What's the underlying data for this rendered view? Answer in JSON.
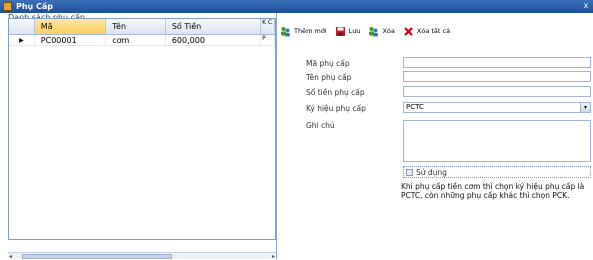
{
  "window": {
    "title": "Phụ Cấp",
    "close_glyph": "x"
  },
  "list": {
    "label": "Danh sách phụ cấp",
    "columns": [
      "Mã",
      "Tên",
      "Số Tiền",
      "K C"
    ],
    "rows": [
      {
        "indicator": "▶",
        "ma": "PC00001",
        "ten": "cơm",
        "so_tien": "600,000",
        "k": "P"
      }
    ],
    "scroll_left": "◂",
    "scroll_right": "▸"
  },
  "toolbar": {
    "add_label": "Thêm mới",
    "save_label": "Lưu",
    "delete_label": "Xóa",
    "delete_all_label": "Xóa tất cả"
  },
  "form": {
    "ma_label": "Mã phụ cấp",
    "ma_value": "",
    "ten_label": "Tên phụ cấp",
    "ten_value": "",
    "so_tien_label": "Số tiền phụ cấp",
    "so_tien_value": "",
    "ky_hieu_label": "Ký hiệu phụ cấp",
    "ky_hieu_value": "PCTC",
    "ghi_chu_label": "Ghi chú",
    "ghi_chu_value": "",
    "su_dung_label": "Sử dụng",
    "note": "Khi phụ cấp tiền cơm thì chọn ký hiệu phụ cấp là PCTC, còn những phụ cấp khác thì chọn PCK."
  }
}
